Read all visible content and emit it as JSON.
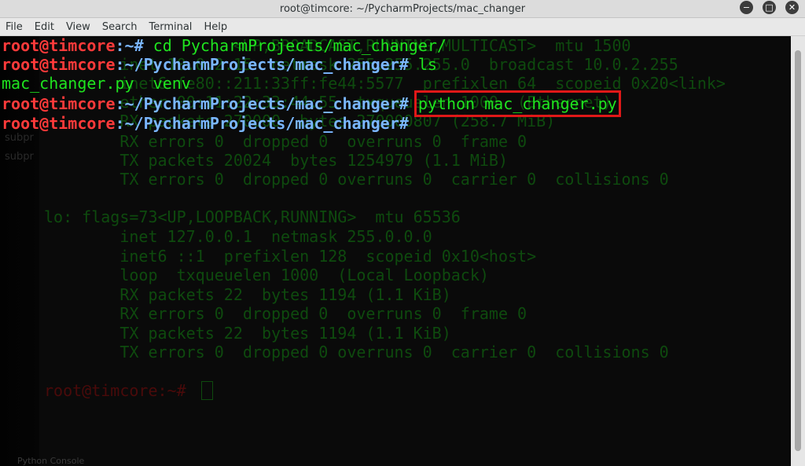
{
  "window": {
    "title": "root@timcore: ~/PycharmProjects/mac_changer"
  },
  "menu": [
    "File",
    "Edit",
    "View",
    "Search",
    "Terminal",
    "Help"
  ],
  "window_buttons": {
    "minimize": "−",
    "maximize": "□",
    "close": "✕"
  },
  "terminal": {
    "lines": [
      {
        "user": "root@timcore",
        "path": ":~",
        "prompt": "# ",
        "cmd": "cd PycharmProjects/mac_changer/"
      },
      {
        "user": "root@timcore",
        "path": ":~/PycharmProjects/mac_changer",
        "prompt": "# ",
        "cmd": "ls"
      },
      {
        "output": "mac_changer.py  venv"
      },
      {
        "user": "root@timcore",
        "path": ":~/PycharmProjects/mac_changer",
        "prompt": "# ",
        "cmd": "python mac_changer.py"
      },
      {
        "user": "root@timcore",
        "path": ":~/PycharmProjects/mac_changer",
        "prompt": "# ",
        "cmd": ""
      }
    ],
    "ghost_lines": [
      "                    <UP,BROADCAST,RUNNING,MULTICAST>  mtu 1500",
      "        inet 10.0.2.15  netmask 255.255.255.0  broadcast 10.0.2.255",
      "        inet6 fe80::211:33ff:fe44:5577  prefixlen 64  scopeid 0x20<link>",
      "        ether 00:11:22:33:44:55  txqueuelen 1000  (Ethernet)",
      "        RX packets 270000  bytes 270000807 (258.7 MiB)",
      "        RX errors 0  dropped 0  overruns 0  frame 0",
      "        TX packets 20024  bytes 1254979 (1.1 MiB)",
      "        TX errors 0  dropped 0 overruns 0  carrier 0  collisions 0",
      "",
      "lo: flags=73<UP,LOOPBACK,RUNNING>  mtu 65536",
      "        inet 127.0.0.1  netmask 255.0.0.0",
      "        inet6 ::1  prefixlen 128  scopeid 0x10<host>",
      "        loop  txqueuelen 1000  (Local Loopback)",
      "        RX packets 22  bytes 1194 (1.1 KiB)",
      "        RX errors 0  dropped 0  overruns 0  frame 0",
      "        TX packets 22  bytes 1194 (1.1 KiB)",
      "        TX errors 0  dropped 0 overruns 0  carrier 0  collisions 0"
    ],
    "ghost_prompt": "root@timcore:~#",
    "ghost_side": [
      "subpr",
      "subpr"
    ]
  },
  "statusbar": {
    "label": "Python Console"
  }
}
